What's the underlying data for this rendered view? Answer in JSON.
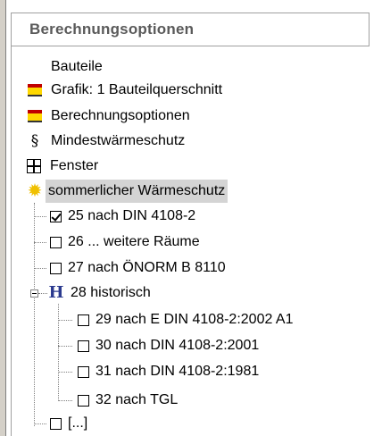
{
  "panel": {
    "title": "Berechnungsoptionen"
  },
  "tree": {
    "items": [
      {
        "label": "Bauteile",
        "icon": "none"
      },
      {
        "label": "Grafik: 1 Bauteilquerschnitt",
        "icon": "card-icon"
      },
      {
        "label": "Berechnungsoptionen",
        "icon": "card-icon"
      },
      {
        "label": "Mindestwärmeschutz",
        "icon": "paragraph-icon"
      },
      {
        "label": "Fenster",
        "icon": "window-icon"
      },
      {
        "label": "sommerlicher Wärmeschutz",
        "icon": "sun-icon",
        "selected": true
      }
    ],
    "children": [
      {
        "label": "25 nach DIN 4108-2",
        "checked": true
      },
      {
        "label": "26 ... weitere Räume",
        "checked": false
      },
      {
        "label": "27 nach ÖNORM B 8110",
        "checked": false
      },
      {
        "label": "28 historisch",
        "icon": "h-icon",
        "expanded": true
      },
      {
        "label": "[...]",
        "checked": false
      }
    ],
    "historisch": [
      {
        "label": "29 nach E DIN 4108-2:2002 A1",
        "checked": false
      },
      {
        "label": "30 nach DIN 4108-2:2001",
        "checked": false
      },
      {
        "label": "31 nach DIN 4108-2:1981",
        "checked": false
      },
      {
        "label": "32 nach TGL",
        "checked": false
      }
    ]
  },
  "colors": {
    "selection": "#d4d4d4",
    "header_text": "#5a5a5a",
    "h_icon": "#2b3a8f"
  }
}
